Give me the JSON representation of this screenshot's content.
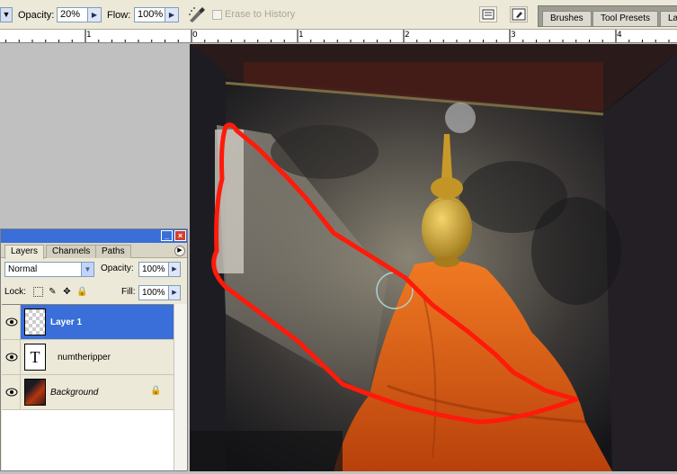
{
  "options_bar": {
    "opacity_label": "Opacity:",
    "opacity_value": "20%",
    "flow_label": "Flow:",
    "flow_value": "100%",
    "erase_to_history_label": "Erase to History",
    "erase_to_history_checked": false,
    "palette_well_tabs": [
      "Brushes",
      "Tool Presets",
      "La"
    ]
  },
  "ruler": {
    "numbers": [
      "1",
      "0",
      "1",
      "2",
      "3",
      "4"
    ]
  },
  "layers_palette": {
    "tabs": [
      "Layers",
      "Channels",
      "Paths"
    ],
    "active_tab": "Layers",
    "blend_mode": "Normal",
    "opacity_label": "Opacity:",
    "opacity_value": "100%",
    "lock_label": "Lock:",
    "fill_label": "Fill:",
    "fill_value": "100%",
    "layers": [
      {
        "name": "Layer 1",
        "selected": true,
        "kind": "transparent"
      },
      {
        "name": "numtheripper",
        "selected": false,
        "kind": "text",
        "thumb_glyph": "T"
      },
      {
        "name": "Background",
        "selected": false,
        "kind": "image",
        "locked": true
      }
    ]
  },
  "colors": {
    "selection_blue": "#3a6ed8",
    "chrome": "#ece9d8",
    "stroke_red": "#ff1a0a",
    "robe_orange": "#e8661a"
  },
  "icons": {
    "airbrush": "airbrush-icon",
    "palette_toggle": "palette-toggle-icon",
    "brush_menu": "brush-menu-icon",
    "eye": "eye-icon",
    "lock": "lock-icon",
    "minimize": "minimize-icon",
    "close": "close-icon"
  }
}
